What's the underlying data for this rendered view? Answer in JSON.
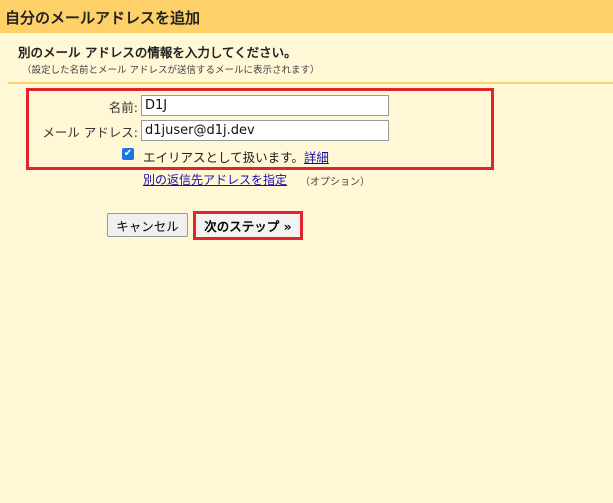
{
  "header": {
    "title": "自分のメールアドレスを追加"
  },
  "instructions": {
    "heading": "別のメール アドレスの情報を入力してください。",
    "note": "（設定した名前とメール アドレスが送信するメールに表示されます）"
  },
  "form": {
    "name_label": "名前:",
    "name_value": "D1J",
    "email_label": "メール アドレス:",
    "email_value": "d1juser@d1j.dev",
    "alias_checked": true,
    "alias_label": "エイリアスとして扱います。",
    "details_link": "詳細",
    "reply_to_link": "別の返信先アドレスを指定",
    "reply_to_option": "（オプション）"
  },
  "buttons": {
    "cancel": "キャンセル",
    "next": "次のステップ »"
  },
  "colors": {
    "header": "#fdd068",
    "background": "#fff7d6",
    "highlight": "#e2242b"
  }
}
